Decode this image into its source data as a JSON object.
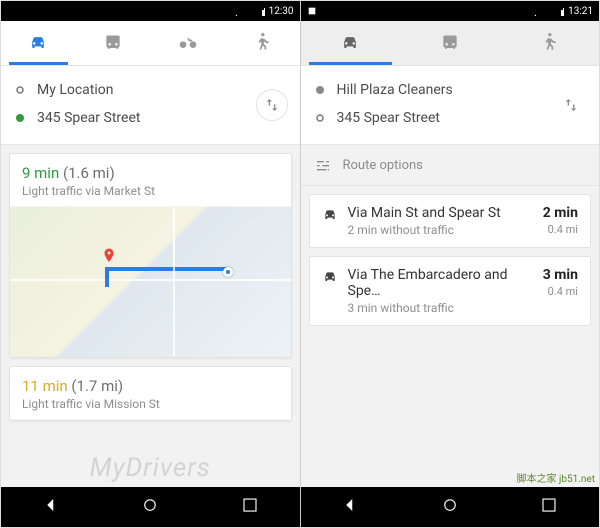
{
  "left": {
    "status_time": "12:30",
    "tabs": {
      "active": "car"
    },
    "from_label": "My Location",
    "to_label": "345 Spear Street",
    "route1": {
      "time": "9 min",
      "dist": "(1.6 mi)",
      "sub": "Light traffic via Market St"
    },
    "route2": {
      "time": "11 min",
      "dist": "(1.7 mi)",
      "sub": "Light traffic via Mission St"
    }
  },
  "right": {
    "status_time": "13:21",
    "tabs": {
      "active": "car"
    },
    "from_label": "Hill Plaza Cleaners",
    "to_label": "345 Spear Street",
    "options_label": "Route options",
    "routes": [
      {
        "via": "Via Main St and Spear St",
        "sub": "2 min without traffic",
        "time": "2 min",
        "dist": "0.4 mi"
      },
      {
        "via": "Via The Embarcadero and Spe…",
        "sub": "3 min without traffic",
        "time": "3 min",
        "dist": "0.4 mi"
      }
    ]
  },
  "watermark": "MyDrivers",
  "corner_text": "脚本之家 jb51.net"
}
